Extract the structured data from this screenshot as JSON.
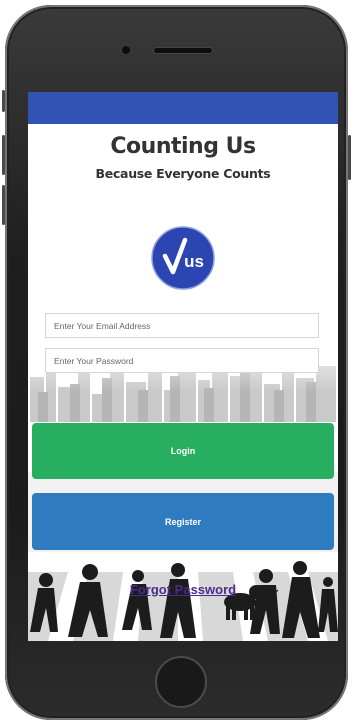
{
  "app": {
    "title": "Counting Us",
    "subtitle": "Because Everyone Counts"
  },
  "logo": {
    "text": "us"
  },
  "form": {
    "email_placeholder": "Enter Your Email Address",
    "password_placeholder": "Enter Your Password"
  },
  "actions": {
    "login_label": "Login",
    "register_label": "Register",
    "forgot_label": "Forgot Password"
  },
  "colors": {
    "status_bar": "#3053b4",
    "login_button": "#27ae60",
    "register_button": "#2f7bbf",
    "logo_blue": "#2b45b3",
    "forgot_link": "#4a2d8a"
  }
}
